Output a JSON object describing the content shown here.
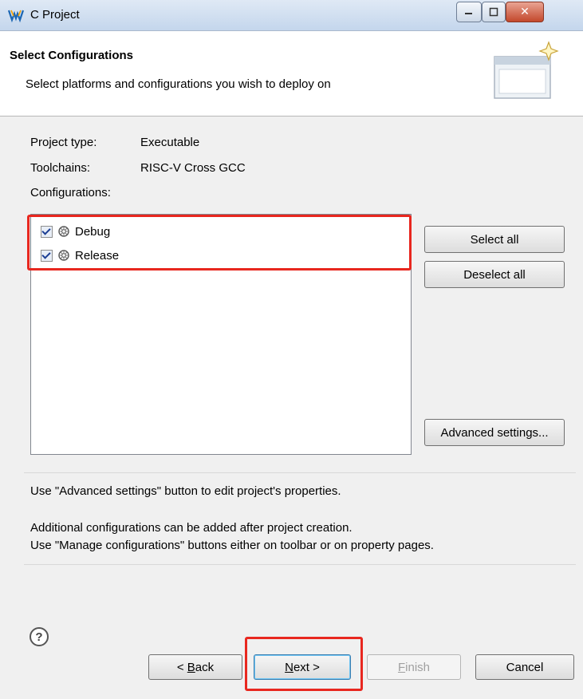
{
  "window": {
    "title": "C Project"
  },
  "header": {
    "title": "Select Configurations",
    "subtitle": "Select platforms and configurations you wish to deploy on"
  },
  "project": {
    "type_label": "Project type:",
    "type_value": "Executable",
    "toolchains_label": "Toolchains:",
    "toolchains_value": "RISC-V Cross GCC",
    "configurations_label": "Configurations:"
  },
  "configurations": [
    {
      "name": "Debug",
      "checked": true
    },
    {
      "name": "Release",
      "checked": true
    }
  ],
  "side_buttons": {
    "select_all": "Select all",
    "deselect_all": "Deselect all",
    "advanced": "Advanced settings..."
  },
  "info": {
    "line1": "Use \"Advanced settings\" button to edit project's properties.",
    "line2": "Additional configurations can be added after project creation.",
    "line3": "Use \"Manage configurations\" buttons either on toolbar or on property pages."
  },
  "footer": {
    "help": "?",
    "back_prefix": "< ",
    "back_mn": "B",
    "back_rest": "ack",
    "next_mn": "N",
    "next_rest": "ext >",
    "finish_mn": "F",
    "finish_rest": "inish",
    "cancel": "Cancel"
  },
  "colors": {
    "highlight": "#e8271f",
    "titlebar": "#c4d6ec",
    "close_button": "#c3482c"
  }
}
